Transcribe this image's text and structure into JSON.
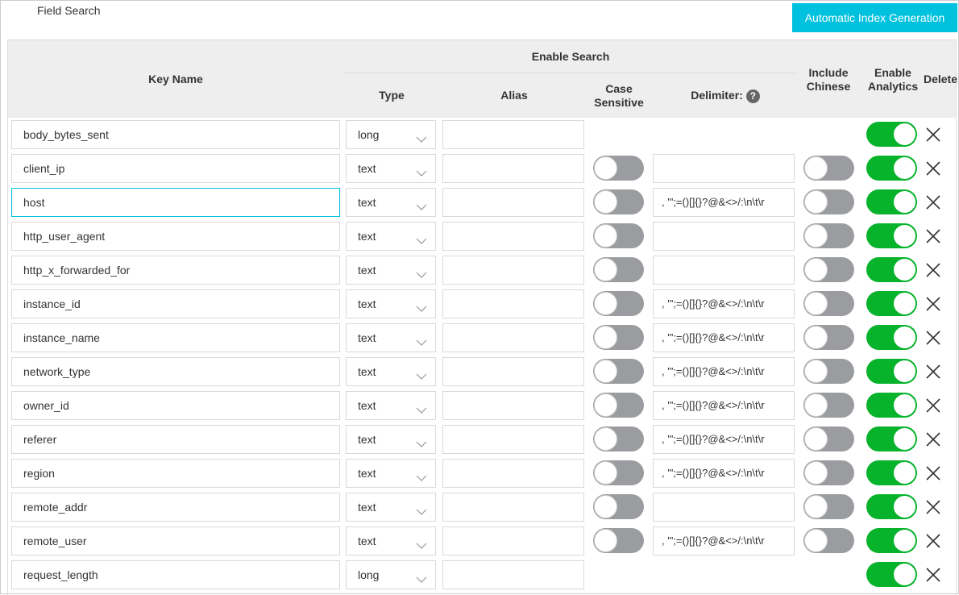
{
  "title": "Field Search",
  "auto_button": "Automatic Index Generation",
  "headers": {
    "key_name": "Key Name",
    "enable_search": "Enable Search",
    "type": "Type",
    "alias": "Alias",
    "case_sensitive": "Case Sensitive",
    "delimiter": "Delimiter:",
    "include_chinese": "Include Chinese",
    "enable_analytics": "Enable Analytics",
    "delete": "Delete"
  },
  "colors": {
    "accent": "#00c1de",
    "toggle_on": "#06b32b",
    "toggle_off": "#9a9c9f"
  },
  "rows": [
    {
      "key": "body_bytes_sent",
      "type": "long",
      "alias": "",
      "case_sensitive": null,
      "delimiter": null,
      "include_chinese": null,
      "enable_analytics": true
    },
    {
      "key": "client_ip",
      "type": "text",
      "alias": "",
      "case_sensitive": false,
      "delimiter": "",
      "include_chinese": false,
      "enable_analytics": true
    },
    {
      "key": "host",
      "type": "text",
      "alias": "",
      "case_sensitive": false,
      "delimiter": ", '\";=()[]{}?@&<>/:\\n\\t\\r",
      "include_chinese": false,
      "enable_analytics": true,
      "focused": true
    },
    {
      "key": "http_user_agent",
      "type": "text",
      "alias": "",
      "case_sensitive": false,
      "delimiter": "",
      "include_chinese": false,
      "enable_analytics": true
    },
    {
      "key": "http_x_forwarded_for",
      "type": "text",
      "alias": "",
      "case_sensitive": false,
      "delimiter": "",
      "include_chinese": false,
      "enable_analytics": true
    },
    {
      "key": "instance_id",
      "type": "text",
      "alias": "",
      "case_sensitive": false,
      "delimiter": ", '\";=()[]{}?@&<>/:\\n\\t\\r",
      "include_chinese": false,
      "enable_analytics": true
    },
    {
      "key": "instance_name",
      "type": "text",
      "alias": "",
      "case_sensitive": false,
      "delimiter": ", '\";=()[]{}?@&<>/:\\n\\t\\r",
      "include_chinese": false,
      "enable_analytics": true
    },
    {
      "key": "network_type",
      "type": "text",
      "alias": "",
      "case_sensitive": false,
      "delimiter": ", '\";=()[]{}?@&<>/:\\n\\t\\r",
      "include_chinese": false,
      "enable_analytics": true
    },
    {
      "key": "owner_id",
      "type": "text",
      "alias": "",
      "case_sensitive": false,
      "delimiter": ", '\";=()[]{}?@&<>/:\\n\\t\\r",
      "include_chinese": false,
      "enable_analytics": true
    },
    {
      "key": "referer",
      "type": "text",
      "alias": "",
      "case_sensitive": false,
      "delimiter": ", '\";=()[]{}?@&<>/:\\n\\t\\r",
      "include_chinese": false,
      "enable_analytics": true
    },
    {
      "key": "region",
      "type": "text",
      "alias": "",
      "case_sensitive": false,
      "delimiter": ", '\";=()[]{}?@&<>/:\\n\\t\\r",
      "include_chinese": false,
      "enable_analytics": true
    },
    {
      "key": "remote_addr",
      "type": "text",
      "alias": "",
      "case_sensitive": false,
      "delimiter": "",
      "include_chinese": false,
      "enable_analytics": true
    },
    {
      "key": "remote_user",
      "type": "text",
      "alias": "",
      "case_sensitive": false,
      "delimiter": ", '\";=()[]{}?@&<>/:\\n\\t\\r",
      "include_chinese": false,
      "enable_analytics": true
    },
    {
      "key": "request_length",
      "type": "long",
      "alias": "",
      "case_sensitive": null,
      "delimiter": null,
      "include_chinese": null,
      "enable_analytics": true
    }
  ]
}
